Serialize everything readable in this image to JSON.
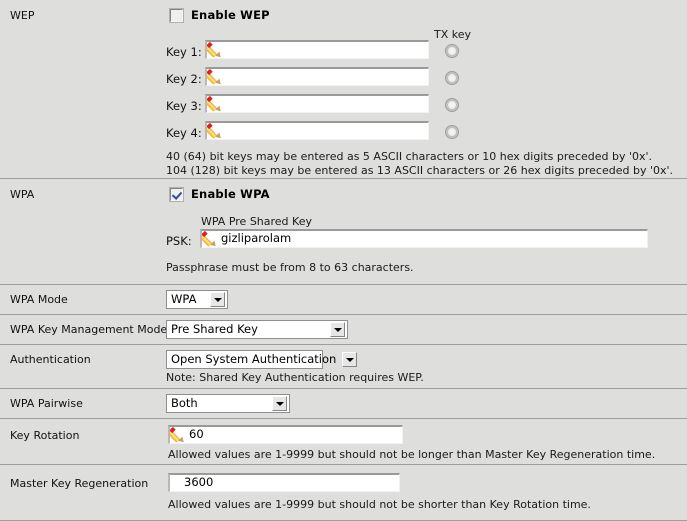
{
  "sections": {
    "wep": {
      "label": "WEP",
      "enable_label": "Enable WEP",
      "enabled": false,
      "txkey_header": "TX key",
      "keys": [
        {
          "label": "Key 1:",
          "value": "",
          "tx_selected": false
        },
        {
          "label": "Key 2:",
          "value": "",
          "tx_selected": false
        },
        {
          "label": "Key 3:",
          "value": "",
          "tx_selected": false
        },
        {
          "label": "Key 4:",
          "value": "",
          "tx_selected": false
        }
      ],
      "help_line1": "40 (64) bit keys may be entered as 5 ASCII characters or 10 hex digits preceded by '0x'.",
      "help_line2": "104 (128) bit keys may be entered as 13 ASCII characters or 26 hex digits preceded by '0x'."
    },
    "wpa": {
      "label": "WPA",
      "enable_label": "Enable WPA",
      "enabled": true,
      "psk_group_label": "WPA Pre Shared Key",
      "psk_label": "PSK:",
      "psk_value": "gizliparolam",
      "help": "Passphrase must be from 8 to 63 characters."
    },
    "wpa_mode": {
      "label": "WPA Mode",
      "value": "WPA"
    },
    "wpa_key_mgmt": {
      "label": "WPA Key Management Mode",
      "value": "Pre Shared Key"
    },
    "authentication": {
      "label": "Authentication",
      "value": "Open System Authentication",
      "note": "Note: Shared Key Authentication requires WEP."
    },
    "wpa_pairwise": {
      "label": "WPA Pairwise",
      "value": "Both"
    },
    "key_rotation": {
      "label": "Key Rotation",
      "value": "60",
      "help": "Allowed values are 1-9999 but should not be longer than Master Key Regeneration time."
    },
    "master_key_regen": {
      "label": "Master Key Regeneration",
      "value": "3600",
      "help": "Allowed values are 1-9999 but should not be shorter than Key Rotation time."
    }
  },
  "colors": {
    "background": "#dededd",
    "divider": "#9e9e9e",
    "field_bg": "#ffffff",
    "check_accent": "#2b4f9e",
    "pencil_body": "#ffd34e",
    "pencil_tip": "#e02020"
  }
}
